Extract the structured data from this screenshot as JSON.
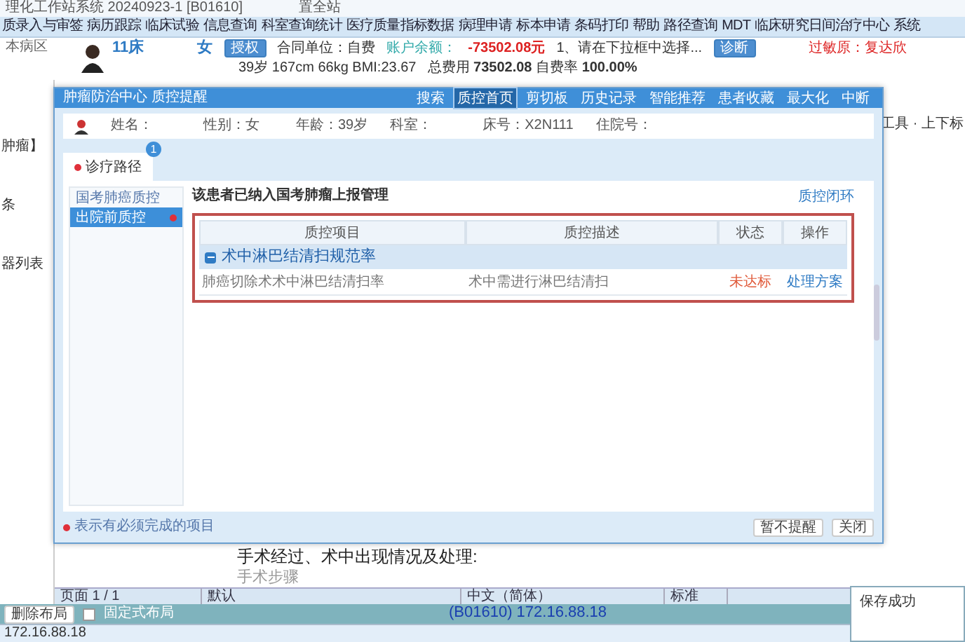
{
  "window": {
    "title": "理化工作站系统 20240923-1 [B01610]",
    "subtitle": "置全站"
  },
  "menu": [
    "质录入与审签",
    "病历跟踪",
    "临床试验",
    "信息查询",
    "科室查询统计",
    "医疗质量指标数据",
    "病理申请",
    "标本申请",
    "条码打印",
    "帮助",
    "路径查询",
    "MDT",
    "临床研究日间治疗中心",
    "系统"
  ],
  "patient_header": {
    "bed": "11床",
    "sex": "女",
    "authorize_button": "授权",
    "contract": "合同单位：自费",
    "balance_label": "账户余额：",
    "balance": "-73502.08元",
    "prompt": "1、请在下拉框中选择...",
    "diagnose_button": "诊断",
    "allergy": "过敏原：复达欣",
    "vitals": "39岁 167cm 66kg BMI:23.67",
    "costs": "总费用 **73502.08** 自费率 **100.00%**"
  },
  "left_panel": {
    "title": "本病区",
    "lines": [
      "肿瘤】",
      "条",
      "器列表"
    ]
  },
  "editor_tools": "工具 · 上下标",
  "document": {
    "lines": [
      "手术经过、术中出现情况及处理:",
      "手术步骤"
    ]
  },
  "doc_status": [
    "页面 1 / 1",
    "默认",
    "中文（简体）",
    "标准"
  ],
  "layout_bar": {
    "button": "删除布局",
    "checkbox": {
      "label": "固定式布局",
      "checked": false
    },
    "host": "(B01610)  172.16.88.18"
  },
  "status_bar": "172.16.88.18",
  "toast": "保存成功",
  "dialog": {
    "title": "肿瘤防治中心 质控提醒",
    "tools": [
      {
        "label": "搜索",
        "selected": false
      },
      {
        "label": "质控首页",
        "selected": true
      },
      {
        "label": "剪切板",
        "selected": false
      },
      {
        "label": "历史记录",
        "selected": false
      },
      {
        "label": "智能推荐",
        "selected": false
      },
      {
        "label": "患者收藏",
        "selected": false
      },
      {
        "label": "最大化",
        "selected": false
      },
      {
        "label": "中断",
        "selected": false
      }
    ],
    "patient": [
      {
        "label": "姓名："
      },
      {
        "label": "性别：",
        "value": "女"
      },
      {
        "label": "年龄：",
        "value": "39岁"
      },
      {
        "label": "科室："
      },
      {
        "label": "床号：",
        "value": "X2N111"
      },
      {
        "label": "住院号："
      }
    ],
    "tabs": [
      {
        "label": "诊疗路径",
        "selected": true,
        "badge": "1"
      }
    ],
    "nav": [
      {
        "label": "国考肺癌质控",
        "selected": false,
        "required": false
      },
      {
        "label": "出院前质控",
        "selected": true,
        "required": true
      }
    ],
    "notice": "该患者已纳入国考肺瘤上报管理",
    "loop_link": "质控闭环",
    "columns": [
      "质控项目",
      "质控描述",
      "状态",
      "操作"
    ],
    "groups": [
      {
        "title": "术中淋巴结清扫规范率",
        "expanded": true,
        "rows": [
          {
            "item": "肺癌切除术术中淋巴结清扫率",
            "description": "术中需进行淋巴结清扫",
            "status": "未达标",
            "kind": "fail",
            "action": "处理方案"
          }
        ]
      }
    ],
    "legend": "表示有必须完成的项目",
    "buttons": [
      "暂不提醒",
      "关闭"
    ]
  }
}
